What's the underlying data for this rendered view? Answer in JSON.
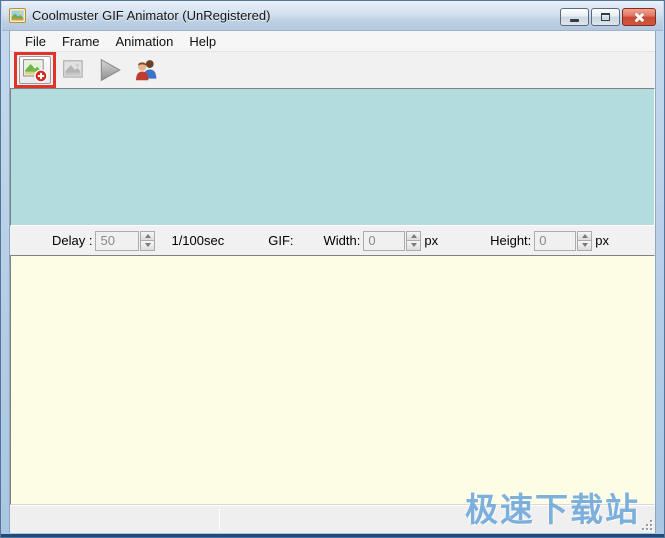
{
  "window": {
    "title": "Coolmuster GIF Animator (UnRegistered)",
    "buttons": {
      "minimize": "minimize-button",
      "maximize": "maximize-button",
      "close": "close-button"
    }
  },
  "menu": {
    "items": [
      {
        "label": "File"
      },
      {
        "label": "Frame"
      },
      {
        "label": "Animation"
      },
      {
        "label": "Help"
      }
    ]
  },
  "toolbar": {
    "buttons": [
      {
        "icon": "add-image-icon",
        "state": "enabled",
        "highlighted": true
      },
      {
        "icon": "image-disabled-icon",
        "state": "disabled"
      },
      {
        "icon": "play-icon",
        "state": "disabled"
      },
      {
        "icon": "register-users-icon",
        "state": "enabled"
      }
    ],
    "highlight_color": "#E0342B"
  },
  "controls": {
    "delay_label": "Delay :",
    "delay_value": "50",
    "delay_unit": "1/100sec",
    "gif_label": "GIF:",
    "width_label": "Width:",
    "width_value": "0",
    "width_unit": "px",
    "height_label": "Height:",
    "height_value": "0",
    "height_unit": "px"
  },
  "statusbar": {
    "left_text": "",
    "right_text": ""
  },
  "watermark": {
    "text": "极速下载站"
  },
  "colors": {
    "annotation-red": "#E0342B",
    "panel-cyan": "#B3DCDF",
    "panel-yellow": "#FDFCE4",
    "watermark-blue": "#63A1D8",
    "close-red": "#C94A33"
  }
}
